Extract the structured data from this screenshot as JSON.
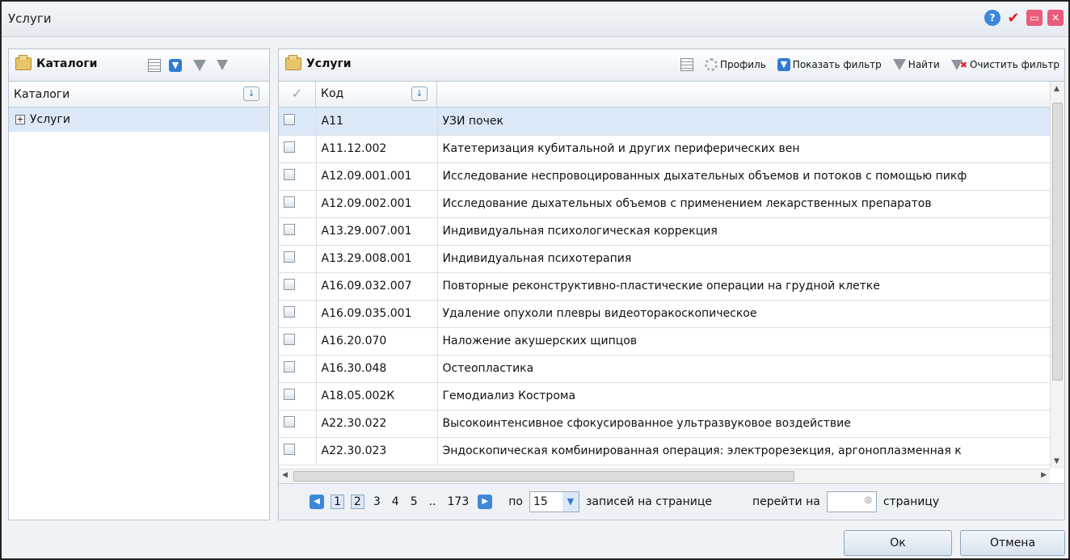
{
  "window": {
    "title": "Услуги"
  },
  "catalogs": {
    "title": "Каталоги",
    "column_header": "Каталоги",
    "tree": [
      {
        "label": "Услуги",
        "expander": "+"
      }
    ]
  },
  "services": {
    "title": "Услуги",
    "toolbar": {
      "profile": "Профиль",
      "show_filter": "Показать фильтр",
      "find": "Найти",
      "clear_filter": "Очистить фильтр"
    },
    "columns": {
      "code": "Код",
      "name": ""
    },
    "rows": [
      {
        "code": "A11",
        "name": "УЗИ почек"
      },
      {
        "code": "A11.12.002",
        "name": "Катетеризация кубитальной и других периферических вен"
      },
      {
        "code": "A12.09.001.001",
        "name": "Исследование неспровоцированных дыхательных объемов и потоков с помощью пикф"
      },
      {
        "code": "A12.09.002.001",
        "name": "Исследование дыхательных объемов с применением лекарственных препаратов"
      },
      {
        "code": "A13.29.007.001",
        "name": "Индивидуальная психологическая коррекция"
      },
      {
        "code": "A13.29.008.001",
        "name": "Индивидуальная психотерапия"
      },
      {
        "code": "A16.09.032.007",
        "name": "Повторные реконструктивно-пластические операции на грудной клетке"
      },
      {
        "code": "A16.09.035.001",
        "name": "Удаление опухоли плевры видеоторакоскопическое"
      },
      {
        "code": "A16.20.070",
        "name": "Наложение акушерских щипцов"
      },
      {
        "code": "A16.30.048",
        "name": "Остеопластика"
      },
      {
        "code": "A18.05.002К",
        "name": "Гемодиализ Кострома"
      },
      {
        "code": "A22.30.022",
        "name": "Высокоинтенсивное сфокусированное ультразвуковое воздействие"
      },
      {
        "code": "A22.30.023",
        "name": "Эндоскопическая комбинированная операция: электрорезекция, аргоноплазменная к"
      }
    ],
    "pager": {
      "pages": [
        "1",
        "2",
        "3",
        "4",
        "5",
        "..",
        "173"
      ],
      "per_page_prefix": "по",
      "per_page_value": "15",
      "per_page_suffix": "записей на странице",
      "goto_prefix": "перейти на",
      "goto_suffix": "страницу",
      "goto_value": ""
    }
  },
  "buttons": {
    "ok": "Ок",
    "cancel": "Отмена"
  }
}
